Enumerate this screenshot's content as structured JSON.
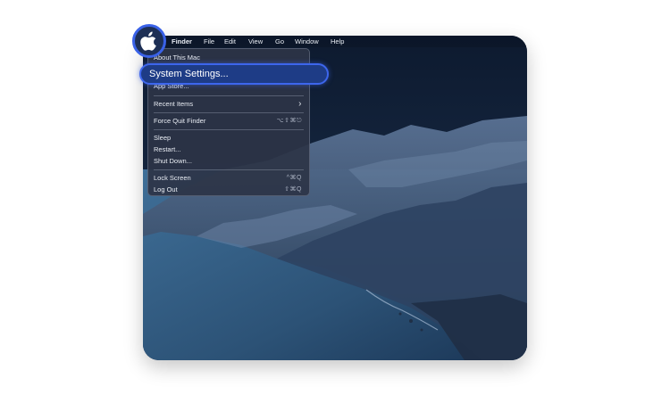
{
  "menubar": {
    "app_name": "Finder",
    "items": [
      "File",
      "Edit",
      "View",
      "Go",
      "Window",
      "Help"
    ]
  },
  "apple_menu": {
    "items": [
      {
        "label": "About This Mac"
      },
      {
        "label": "System Settings..."
      },
      {
        "label": "App Store..."
      },
      {
        "label": "Recent Items",
        "shortcut": "›"
      },
      {
        "label": "Force Quit Finder",
        "shortcut": "⌥⇧⌘⎋"
      },
      {
        "label": "Sleep"
      },
      {
        "label": "Restart..."
      },
      {
        "label": "Shut Down..."
      },
      {
        "label": "Lock Screen",
        "shortcut": "^⌘Q"
      },
      {
        "label": "Log Out",
        "shortcut": "⇧⌘Q"
      }
    ]
  },
  "colors": {
    "highlight_border": "#3d66ec",
    "highlight_fill": "#1e3c86"
  },
  "icons": {
    "apple": "apple-logo-icon"
  }
}
